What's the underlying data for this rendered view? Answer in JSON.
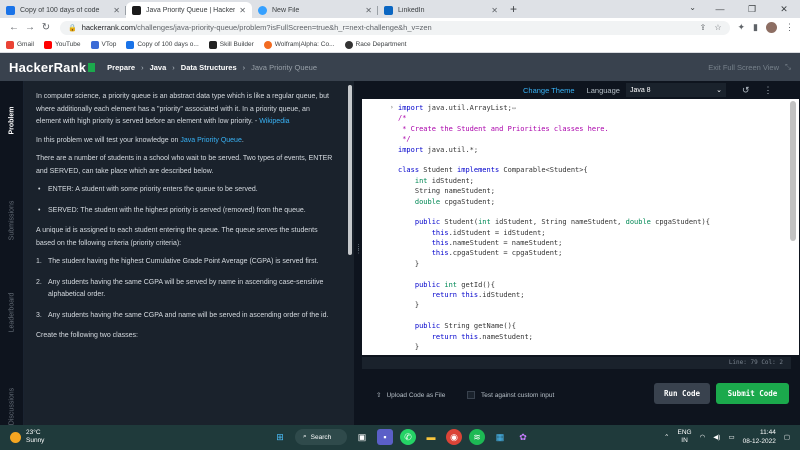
{
  "browser": {
    "tabs": [
      {
        "title": "Copy of 100 days of code",
        "favicon_color": "#1a73e8"
      },
      {
        "title": "Java Priority Queue | HackerRank",
        "favicon_color": "#1a1a1a"
      },
      {
        "title": "New File",
        "favicon_color": "#35a0ff"
      },
      {
        "title": "LinkedIn",
        "favicon_color": "#0a66c2"
      }
    ],
    "url_host": "hackerrank.com",
    "url_path": "/challenges/java-priority-queue/problem?isFullScreen=true&h_r=next-challenge&h_v=zen",
    "bookmarks": [
      {
        "label": "Gmail",
        "color": "#ea4335"
      },
      {
        "label": "YouTube",
        "color": "#ff0000"
      },
      {
        "label": "VTop",
        "color": "#3b6bd6"
      },
      {
        "label": "Copy of 100 days o...",
        "color": "#1a73e8"
      },
      {
        "label": "Skill Builder",
        "color": "#222222"
      },
      {
        "label": "Wolfram|Alpha: Co...",
        "color": "#f26b21"
      },
      {
        "label": "Race Department",
        "color": "#333333"
      }
    ]
  },
  "header": {
    "logo": "HackerRank",
    "crumbs": [
      "Prepare",
      "Java",
      "Data Structures",
      "Java Priority Queue"
    ],
    "exit_fullscreen": "Exit Full Screen View"
  },
  "sidetabs": [
    "Problem",
    "Submissions",
    "Leaderboard",
    "Discussions"
  ],
  "problem": {
    "intro": "In computer science, a priority queue is an abstract data type which is like a regular queue, but where additionally each element has a \"priority\" associated with it. In a priority queue, an element with high priority is served before an element with low priority. - ",
    "wiki_link": "Wikipedia",
    "test_pre": "In this problem we will test your knowledge on ",
    "test_link": "Java Priority Queue",
    "test_post": ".",
    "events_text": "There are a number of students in a school who wait to be served. Two types of events, ENTER and SERVED, can take place which are described below.",
    "events": [
      "ENTER: A student with some priority enters the queue to be served.",
      "SERVED: The student with the highest priority is served (removed) from the queue."
    ],
    "unique_text": "A unique id is assigned to each student entering the queue. The queue serves the students based on the following criteria (priority criteria):",
    "criteria": [
      {
        "num": "1.",
        "text": "The student having the highest Cumulative Grade Point Average (CGPA) is served first."
      },
      {
        "num": "2.",
        "text": "Any students having the same CGPA will be served by name in ascending case-sensitive alphabetical order."
      },
      {
        "num": "3.",
        "text": "Any students having the same CGPA and name will be served in ascending order of the id."
      }
    ],
    "create_text": "Create the following two classes:"
  },
  "editor": {
    "change_theme": "Change Theme",
    "language_label": "Language",
    "language_value": "Java 8",
    "status": "Line: 79 Col: 2"
  },
  "bottom": {
    "upload": "Upload Code as File",
    "custom_input": "Test against custom input",
    "run": "Run Code",
    "submit": "Submit Code"
  },
  "taskbar": {
    "temp": "23°C",
    "weather": "Sunny",
    "search": "Search",
    "lang_top": "ENG",
    "lang_bottom": "IN",
    "time": "11:44",
    "date": "08-12-2022"
  }
}
